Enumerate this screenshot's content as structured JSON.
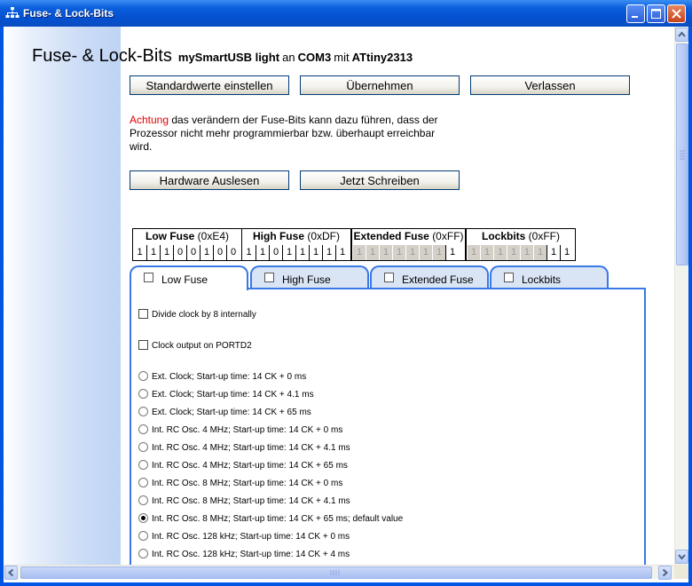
{
  "window": {
    "title": "Fuse- & Lock-Bits"
  },
  "heading": {
    "title": "Fuse- & Lock-Bits",
    "programmer": "mySmartUSB light",
    "an": "an",
    "port": "COM3",
    "mit": "mit",
    "device": "ATtiny2313"
  },
  "buttons": {
    "defaults": "Standardwerte einstellen",
    "apply": "Übernehmen",
    "exit": "Verlassen",
    "read": "Hardware Auslesen",
    "write": "Jetzt Schreiben"
  },
  "warning": {
    "prefix": "Achtung",
    "text": " das verändern der Fuse-Bits kann dazu führen, dass der Prozessor nicht mehr programmierbar bzw. überhaupt erreichbar wird."
  },
  "fuses": [
    {
      "name": "Low Fuse",
      "hex": "(0xE4)",
      "bits": [
        "1",
        "1",
        "1",
        "0",
        "0",
        "1",
        "0",
        "0"
      ],
      "disabled": [
        false,
        false,
        false,
        false,
        false,
        false,
        false,
        false
      ]
    },
    {
      "name": "High Fuse",
      "hex": "(0xDF)",
      "bits": [
        "1",
        "1",
        "0",
        "1",
        "1",
        "1",
        "1",
        "1"
      ],
      "disabled": [
        false,
        false,
        false,
        false,
        false,
        false,
        false,
        false
      ]
    },
    {
      "name": "Extended Fuse",
      "hex": "(0xFF)",
      "bits": [
        "1",
        "1",
        "1",
        "1",
        "1",
        "1",
        "1",
        "1"
      ],
      "disabled": [
        true,
        true,
        true,
        true,
        true,
        true,
        true,
        false
      ]
    },
    {
      "name": "Lockbits",
      "hex": "(0xFF)",
      "bits": [
        "1",
        "1",
        "1",
        "1",
        "1",
        "1",
        "1",
        "1"
      ],
      "disabled": [
        true,
        true,
        true,
        true,
        true,
        true,
        false,
        false
      ]
    }
  ],
  "tabs": [
    {
      "label": "Low Fuse",
      "active": true
    },
    {
      "label": "High Fuse",
      "active": false
    },
    {
      "label": "Extended Fuse",
      "active": false
    },
    {
      "label": "Lockbits",
      "active": false
    }
  ],
  "checkboxes": [
    {
      "label": "Divide clock by 8 internally",
      "checked": false
    },
    {
      "label": "Clock output on PORTD2",
      "checked": false
    }
  ],
  "radios": [
    {
      "label": "Ext. Clock; Start-up time: 14 CK + 0 ms",
      "checked": false
    },
    {
      "label": "Ext. Clock; Start-up time: 14 CK + 4.1 ms",
      "checked": false
    },
    {
      "label": "Ext. Clock; Start-up time: 14 CK + 65 ms",
      "checked": false
    },
    {
      "label": "Int. RC Osc. 4 MHz; Start-up time: 14 CK + 0 ms",
      "checked": false
    },
    {
      "label": "Int. RC Osc. 4 MHz; Start-up time: 14 CK + 4.1 ms",
      "checked": false
    },
    {
      "label": "Int. RC Osc. 4 MHz; Start-up time: 14 CK + 65 ms",
      "checked": false
    },
    {
      "label": "Int. RC Osc. 8 MHz; Start-up time: 14 CK + 0 ms",
      "checked": false
    },
    {
      "label": "Int. RC Osc. 8 MHz; Start-up time: 14 CK + 4.1 ms",
      "checked": false
    },
    {
      "label": "Int. RC Osc. 8 MHz; Start-up time: 14 CK + 65 ms; default value",
      "checked": true
    },
    {
      "label": "Int. RC Osc. 128 kHz; Start-up time: 14 CK + 0 ms",
      "checked": false
    },
    {
      "label": "Int. RC Osc. 128 kHz; Start-up time: 14 CK + 4 ms",
      "checked": false
    }
  ]
}
